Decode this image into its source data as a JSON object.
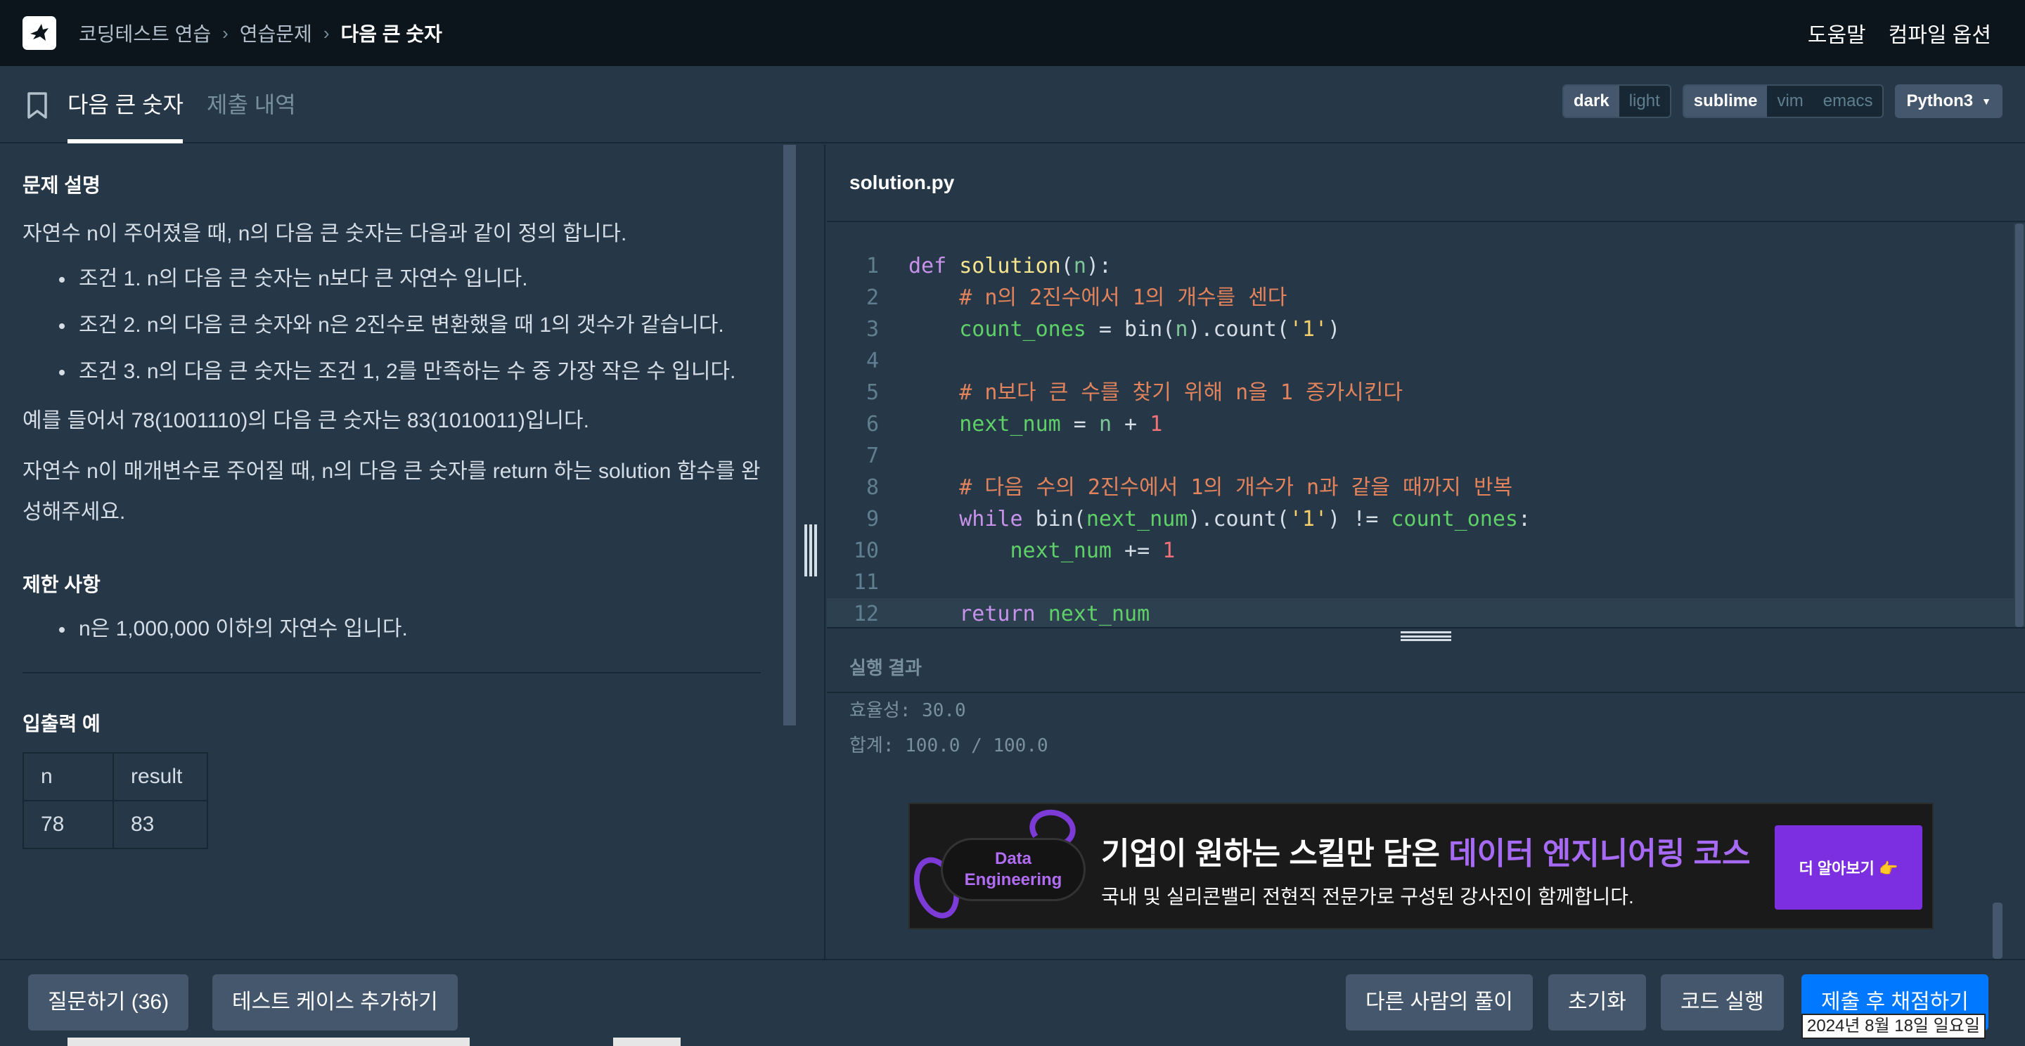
{
  "nav": {
    "breadcrumbs": [
      "코딩테스트 연습",
      "연습문제",
      "다음 큰 숫자"
    ],
    "help": "도움말",
    "compile_options": "컴파일 옵션"
  },
  "tabs": {
    "active": "다음 큰 숫자",
    "inactive": "제출 내역"
  },
  "theme": {
    "dark": "dark",
    "light": "light",
    "selected": "dark"
  },
  "keymap": {
    "sublime": "sublime",
    "vim": "vim",
    "emacs": "emacs",
    "selected": "sublime"
  },
  "language": "Python3",
  "problem": {
    "desc_heading": "문제 설명",
    "intro": "자연수 n이 주어졌을 때, n의 다음 큰 숫자는 다음과 같이 정의 합니다.",
    "conditions": [
      "조건 1. n의 다음 큰 숫자는 n보다 큰 자연수 입니다.",
      "조건 2. n의 다음 큰 숫자와 n은 2진수로 변환했을 때 1의 갯수가 같습니다.",
      "조건 3. n의 다음 큰 숫자는 조건 1, 2를 만족하는 수 중 가장 작은 수 입니다."
    ],
    "example": "예를 들어서 78(1001110)의 다음 큰 숫자는 83(1010011)입니다.",
    "task": "자연수 n이 매개변수로 주어질 때, n의 다음 큰 숫자를 return 하는 solution 함수를 완성해주세요.",
    "limits_heading": "제한 사항",
    "limits": [
      "n은 1,000,000 이하의 자연수 입니다."
    ],
    "io_heading": "입출력 예",
    "io_table": {
      "headers": [
        "n",
        "result"
      ],
      "rows": [
        [
          "78",
          "83"
        ]
      ]
    }
  },
  "editor": {
    "filename": "solution.py",
    "line_numbers": [
      "1",
      "2",
      "3",
      "4",
      "5",
      "6",
      "7",
      "8",
      "9",
      "10",
      "11",
      "12"
    ],
    "lines": [
      "def solution(n):",
      "    # n의 2진수에서 1의 개수를 센다",
      "    count_ones = bin(n).count('1')",
      "",
      "    # n보다 큰 수를 찾기 위해 n을 1 증가시킨다",
      "    next_num = n + 1",
      "",
      "    # 다음 수의 2진수에서 1의 개수가 n과 같을 때까지 반복",
      "    while bin(next_num).count('1') != count_ones:",
      "        next_num += 1",
      "",
      "    return next_num"
    ]
  },
  "result": {
    "heading": "실행 결과",
    "lines": [
      "효율성: 30.0",
      "합계: 100.0 / 100.0"
    ]
  },
  "ad": {
    "logo_line1": "Data",
    "logo_line2": "Engineering",
    "title_prefix": "기업이 원하는 스킬만 담은 ",
    "title_highlight": "데이터 엔지니어링 코스",
    "subtitle": "국내 및 실리콘밸리 전현직 전문가로 구성된 강사진이 함께합니다.",
    "button": "더 알아보기 👉"
  },
  "buttons": {
    "questions": "질문하기 (36)",
    "add_testcase": "테스트 케이스 추가하기",
    "others_solutions": "다른 사람의 풀이",
    "reset": "초기화",
    "run": "코드 실행",
    "submit": "제출 후 채점하기"
  },
  "system_date": "2024년 8월 18일 일요일",
  "colors": {
    "accent": "#0078ff",
    "header_bg": "#0c151c",
    "panel_bg": "#263747",
    "ad_purple": "#7c2fe0"
  }
}
